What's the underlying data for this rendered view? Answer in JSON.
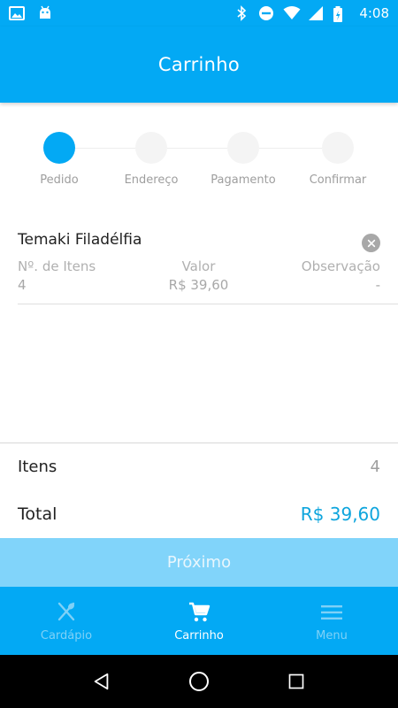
{
  "status_bar": {
    "time": "4:08",
    "left_icons": [
      "image-icon",
      "android-icon"
    ],
    "right_icons": [
      "bluetooth-icon",
      "dnd-icon",
      "wifi-icon",
      "signal-icon",
      "battery-icon"
    ]
  },
  "app_bar": {
    "title": "Carrinho"
  },
  "stepper": {
    "steps": [
      {
        "label": "Pedido",
        "active": true
      },
      {
        "label": "Endereço",
        "active": false
      },
      {
        "label": "Pagamento",
        "active": false
      },
      {
        "label": "Confirmar",
        "active": false
      }
    ]
  },
  "cart": {
    "items": [
      {
        "name": "Temaki Filadélfia",
        "qty_label": "Nº. de Itens",
        "qty": "4",
        "price_label": "Valor",
        "price": "R$ 39,60",
        "note_label": "Observação",
        "note": "-"
      }
    ]
  },
  "summary": {
    "items_label": "Itens",
    "items_count": "4",
    "total_label": "Total",
    "total_value": "R$ 39,60"
  },
  "next_button": {
    "label": "Próximo"
  },
  "bottom_nav": {
    "items": [
      {
        "label": "Cardápio",
        "icon": "cutlery-icon",
        "active": false
      },
      {
        "label": "Carrinho",
        "icon": "cart-icon",
        "active": true
      },
      {
        "label": "Menu",
        "icon": "hamburger-icon",
        "active": false
      }
    ]
  },
  "colors": {
    "primary": "#03a9f4",
    "primary_light": "#81d4fa",
    "total_accent": "#0ea5dd",
    "inactive_nav": "#7fd1f7"
  }
}
